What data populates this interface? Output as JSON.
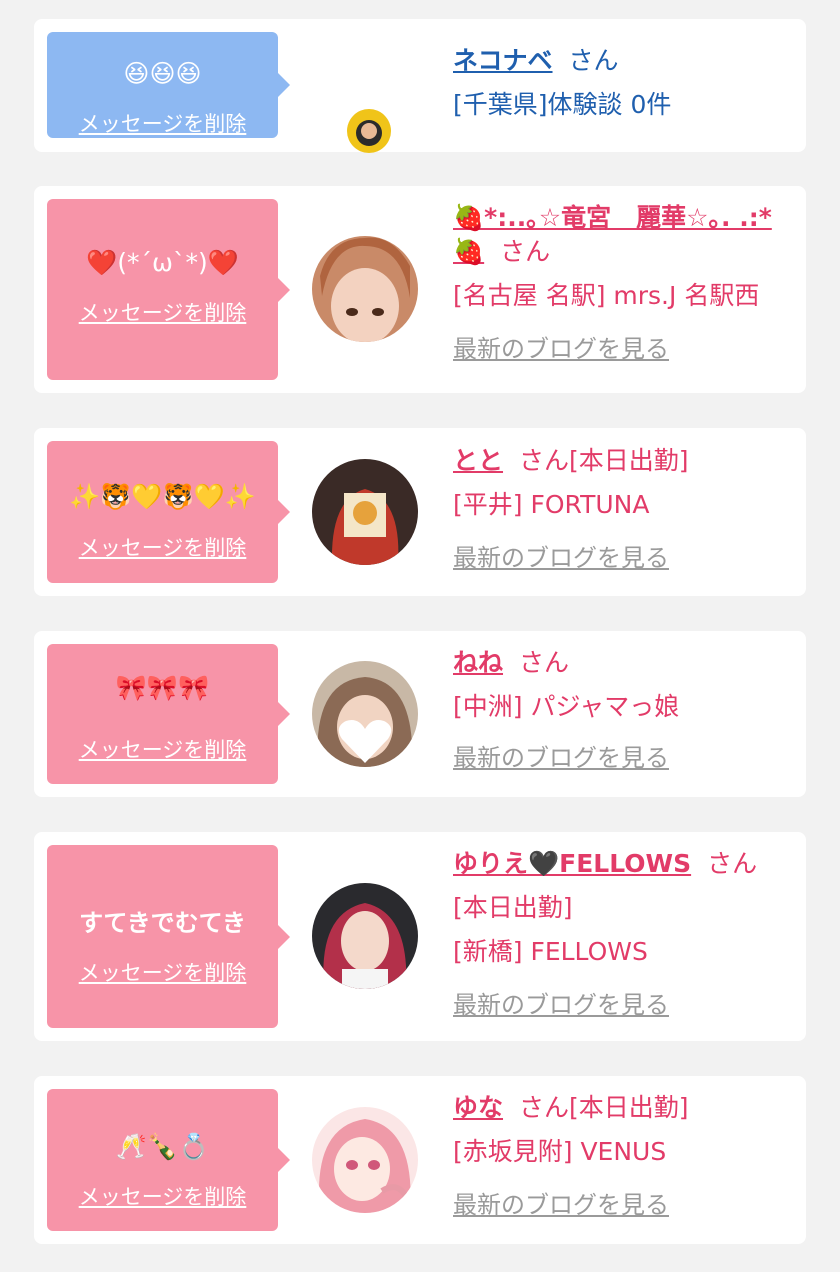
{
  "delete_label": "メッセージを削除",
  "blog_label": "最新のブログを見る",
  "honorific": "さん",
  "colors": {
    "blue_bubble": "#8db8f2",
    "pink_bubble": "#f794a8",
    "pink_text": "#e23b68",
    "blue_text": "#1f5fae",
    "link_gray": "#9a9a9a"
  },
  "cards": [
    {
      "message": "😆😆😆",
      "name": "ネコナベ",
      "shop": "[千葉県]体験談 0件",
      "extra": ""
    },
    {
      "message": "❤️(*´ω`*)❤️",
      "name_line1": "🍓*:..｡☆竜宮　麗華☆｡. .:*",
      "name_line2": "🍓",
      "shop": "[名古屋 名駅] mrs.J 名駅西"
    },
    {
      "message": "✨🐯💛🐯💛✨",
      "name": "とと",
      "status": "[本日出勤]",
      "shop": "[平井] FORTUNA"
    },
    {
      "message": "🎀🎀🎀",
      "name": "ねね",
      "shop": "[中洲] パジャマっ娘"
    },
    {
      "message": "すてきでむてき",
      "name": "ゆりえ🖤FELLOWS",
      "status": "[本日出勤]",
      "shop": "[新橋] FELLOWS"
    },
    {
      "message": "🥂🍾💍",
      "name": "ゆな",
      "status": "[本日出勤]",
      "shop": "[赤坂見附] VENUS"
    }
  ]
}
